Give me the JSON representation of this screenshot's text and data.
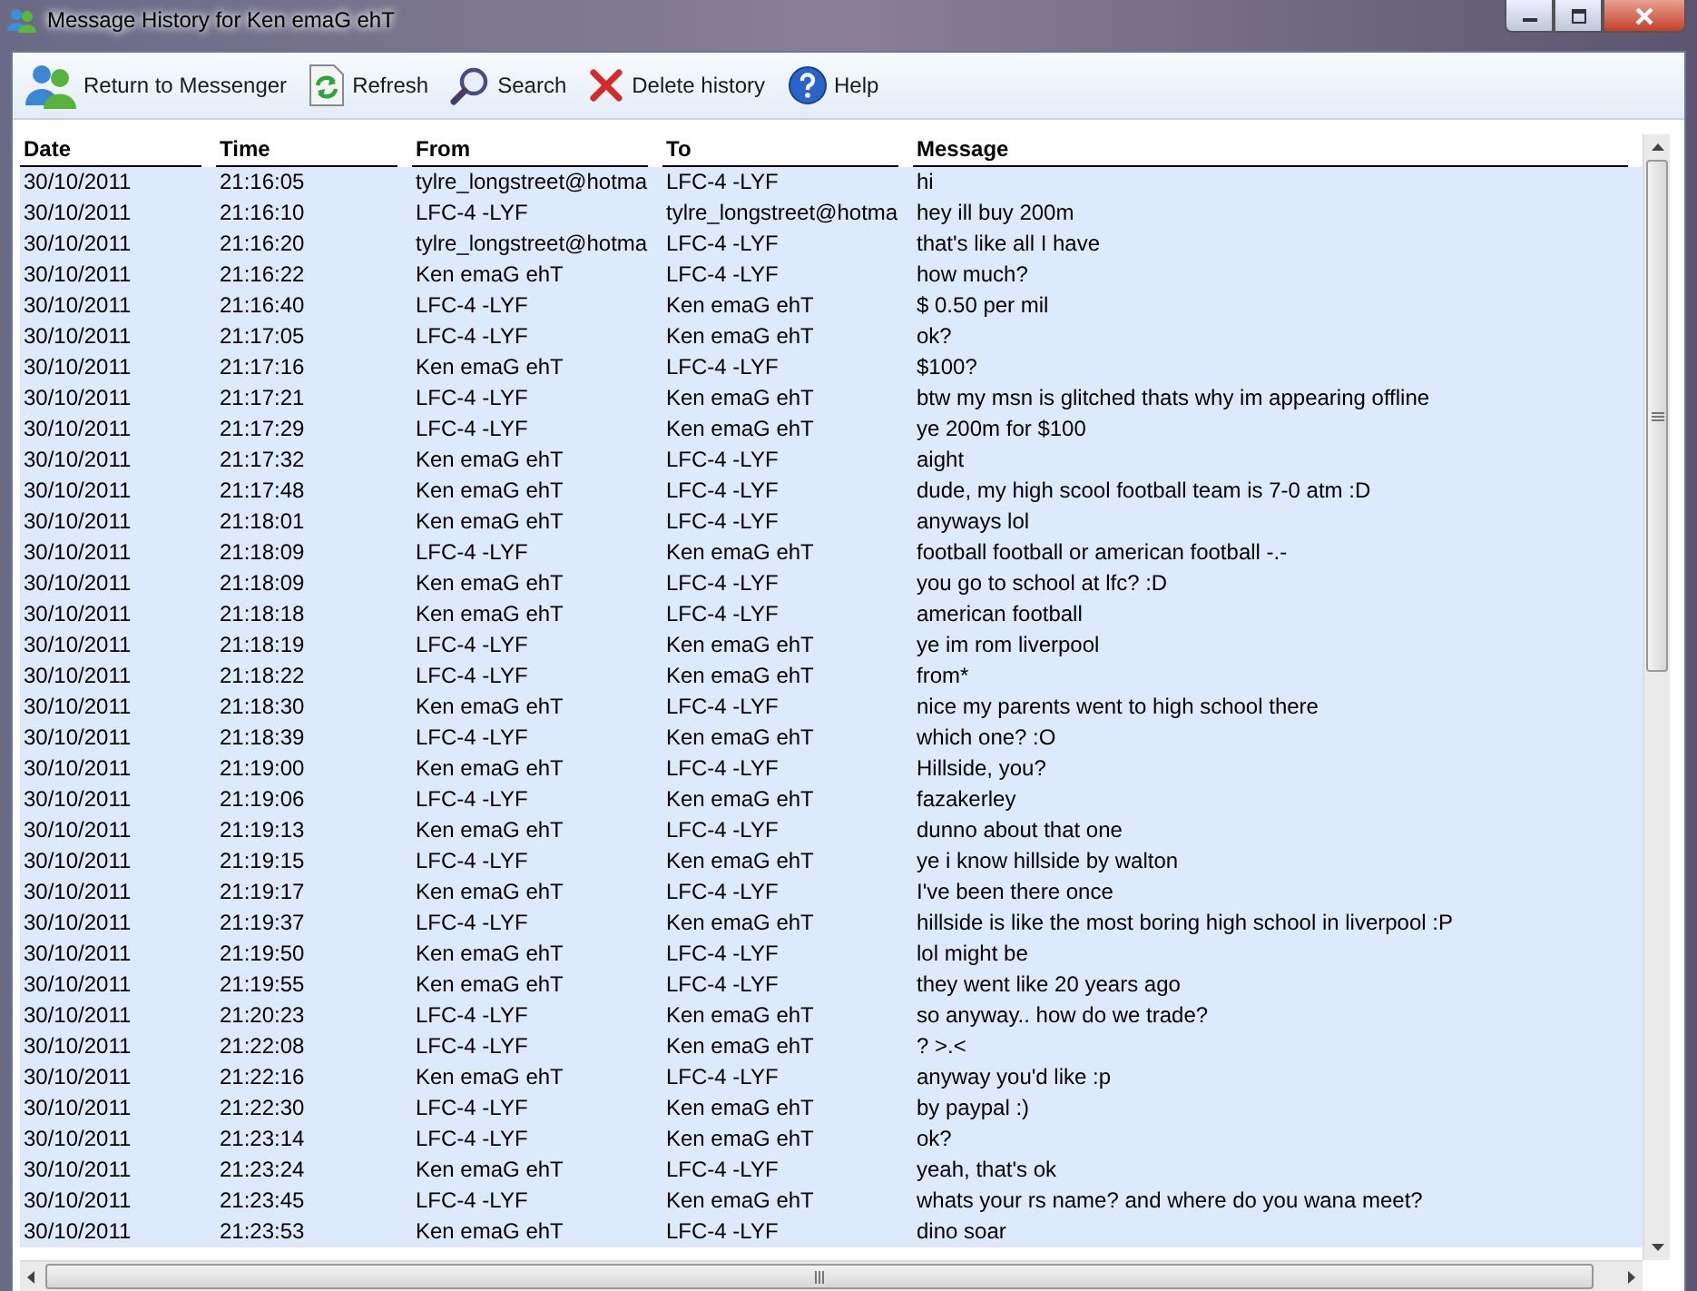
{
  "window": {
    "title": "Message History for Ken emaG ehT"
  },
  "toolbar": [
    {
      "kind": "messenger",
      "label": "Return to Messenger"
    },
    {
      "kind": "refresh",
      "label": "Refresh"
    },
    {
      "kind": "search",
      "label": "Search"
    },
    {
      "kind": "delete",
      "label": "Delete history"
    },
    {
      "kind": "help",
      "label": "Help"
    }
  ],
  "table": {
    "columns": [
      "Date",
      "Time",
      "From",
      "To",
      "Message"
    ],
    "rows": [
      {
        "date": "30/10/2011",
        "time": "21:16:05",
        "from": "tylre_longstreet@hotma",
        "to": "LFC-4 -LYF",
        "message": "hi",
        "selected": true
      },
      {
        "date": "30/10/2011",
        "time": "21:16:10",
        "from": "LFC-4 -LYF",
        "to": "tylre_longstreet@hotma",
        "message": "hey ill buy 200m",
        "selected": true
      },
      {
        "date": "30/10/2011",
        "time": "21:16:20",
        "from": "tylre_longstreet@hotma",
        "to": "LFC-4 -LYF",
        "message": "that's like all I have",
        "selected": true
      },
      {
        "date": "30/10/2011",
        "time": "21:16:22",
        "from": "Ken emaG ehT",
        "to": "LFC-4 -LYF",
        "message": "how much?",
        "selected": true
      },
      {
        "date": "30/10/2011",
        "time": "21:16:40",
        "from": "LFC-4 -LYF",
        "to": "Ken emaG ehT",
        "message": "$ 0.50 per mil",
        "selected": true
      },
      {
        "date": "30/10/2011",
        "time": "21:17:05",
        "from": "LFC-4 -LYF",
        "to": "Ken emaG ehT",
        "message": "ok?",
        "selected": true
      },
      {
        "date": "30/10/2011",
        "time": "21:17:16",
        "from": "Ken emaG ehT",
        "to": "LFC-4 -LYF",
        "message": "$100?",
        "selected": true
      },
      {
        "date": "30/10/2011",
        "time": "21:17:21",
        "from": "LFC-4 -LYF",
        "to": "Ken emaG ehT",
        "message": "btw my msn is glitched thats why im appearing offline",
        "selected": true
      },
      {
        "date": "30/10/2011",
        "time": "21:17:29",
        "from": "LFC-4 -LYF",
        "to": "Ken emaG ehT",
        "message": "ye 200m for $100",
        "selected": true
      },
      {
        "date": "30/10/2011",
        "time": "21:17:32",
        "from": "Ken emaG ehT",
        "to": "LFC-4 -LYF",
        "message": "aight",
        "selected": true
      },
      {
        "date": "30/10/2011",
        "time": "21:17:48",
        "from": "Ken emaG ehT",
        "to": "LFC-4 -LYF",
        "message": "dude, my high scool football team is 7-0 atm :D",
        "selected": true
      },
      {
        "date": "30/10/2011",
        "time": "21:18:01",
        "from": "Ken emaG ehT",
        "to": "LFC-4 -LYF",
        "message": "anyways lol",
        "selected": true
      },
      {
        "date": "30/10/2011",
        "time": "21:18:09",
        "from": "LFC-4 -LYF",
        "to": "Ken emaG ehT",
        "message": "football football or american football -.-",
        "selected": true
      },
      {
        "date": "30/10/2011",
        "time": "21:18:09",
        "from": "Ken emaG ehT",
        "to": "LFC-4 -LYF",
        "message": "you go to school at lfc? :D",
        "selected": true
      },
      {
        "date": "30/10/2011",
        "time": "21:18:18",
        "from": "Ken emaG ehT",
        "to": "LFC-4 -LYF",
        "message": "american football",
        "selected": true
      },
      {
        "date": "30/10/2011",
        "time": "21:18:19",
        "from": "LFC-4 -LYF",
        "to": "Ken emaG ehT",
        "message": "ye im rom liverpool",
        "selected": true
      },
      {
        "date": "30/10/2011",
        "time": "21:18:22",
        "from": "LFC-4 -LYF",
        "to": "Ken emaG ehT",
        "message": "from*",
        "selected": true
      },
      {
        "date": "30/10/2011",
        "time": "21:18:30",
        "from": "Ken emaG ehT",
        "to": "LFC-4 -LYF",
        "message": "nice my parents went to high school there",
        "selected": true
      },
      {
        "date": "30/10/2011",
        "time": "21:18:39",
        "from": "LFC-4 -LYF",
        "to": "Ken emaG ehT",
        "message": "which one? :O",
        "selected": true
      },
      {
        "date": "30/10/2011",
        "time": "21:19:00",
        "from": "Ken emaG ehT",
        "to": "LFC-4 -LYF",
        "message": "Hillside, you?",
        "selected": true
      },
      {
        "date": "30/10/2011",
        "time": "21:19:06",
        "from": "LFC-4 -LYF",
        "to": "Ken emaG ehT",
        "message": "fazakerley",
        "selected": true
      },
      {
        "date": "30/10/2011",
        "time": "21:19:13",
        "from": "Ken emaG ehT",
        "to": "LFC-4 -LYF",
        "message": "dunno about that one",
        "selected": true
      },
      {
        "date": "30/10/2011",
        "time": "21:19:15",
        "from": "LFC-4 -LYF",
        "to": "Ken emaG ehT",
        "message": "ye i know hillside by walton",
        "selected": true
      },
      {
        "date": "30/10/2011",
        "time": "21:19:17",
        "from": "Ken emaG ehT",
        "to": "LFC-4 -LYF",
        "message": "I've been there once",
        "selected": true
      },
      {
        "date": "30/10/2011",
        "time": "21:19:37",
        "from": "LFC-4 -LYF",
        "to": "Ken emaG ehT",
        "message": "hillside is like the most boring high school in liverpool :P",
        "selected": true
      },
      {
        "date": "30/10/2011",
        "time": "21:19:50",
        "from": "Ken emaG ehT",
        "to": "LFC-4 -LYF",
        "message": "lol might be",
        "selected": true
      },
      {
        "date": "30/10/2011",
        "time": "21:19:55",
        "from": "Ken emaG ehT",
        "to": "LFC-4 -LYF",
        "message": "they went like 20 years ago",
        "selected": true
      },
      {
        "date": "30/10/2011",
        "time": "21:20:23",
        "from": "LFC-4 -LYF",
        "to": "Ken emaG ehT",
        "message": "so anyway.. how do we trade?",
        "selected": true
      },
      {
        "date": "30/10/2011",
        "time": "21:22:08",
        "from": "LFC-4 -LYF",
        "to": "Ken emaG ehT",
        "message": "? >.<",
        "selected": true
      },
      {
        "date": "30/10/2011",
        "time": "21:22:16",
        "from": "Ken emaG ehT",
        "to": "LFC-4 -LYF",
        "message": "anyway you'd like :p",
        "selected": true
      },
      {
        "date": "30/10/2011",
        "time": "21:22:30",
        "from": "LFC-4 -LYF",
        "to": "Ken emaG ehT",
        "message": "by paypal :)",
        "selected": true
      },
      {
        "date": "30/10/2011",
        "time": "21:23:14",
        "from": "LFC-4 -LYF",
        "to": "Ken emaG ehT",
        "message": "ok?",
        "selected": true
      },
      {
        "date": "30/10/2011",
        "time": "21:23:24",
        "from": "Ken emaG ehT",
        "to": "LFC-4 -LYF",
        "message": "yeah, that's ok",
        "selected": true
      },
      {
        "date": "30/10/2011",
        "time": "21:23:45",
        "from": "LFC-4 -LYF",
        "to": "Ken emaG ehT",
        "message": "whats your rs name? and where do you wana meet?",
        "selected": true
      },
      {
        "date": "30/10/2011",
        "time": "21:23:53",
        "from": "Ken emaG ehT",
        "to": "LFC-4 -LYF",
        "message": "dino soar",
        "selected": true
      }
    ]
  }
}
